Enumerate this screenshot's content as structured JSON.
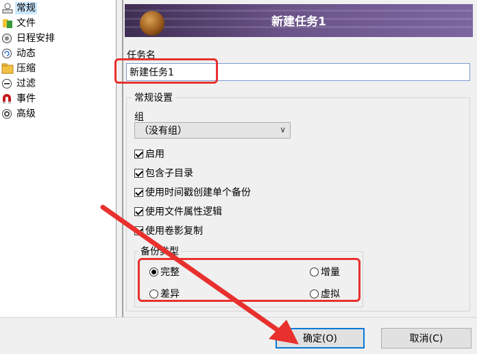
{
  "sidebar": {
    "items": [
      {
        "label": "常规",
        "icon": "general-icon",
        "selected": true
      },
      {
        "label": "文件",
        "icon": "file-icon"
      },
      {
        "label": "日程安排",
        "icon": "schedule-icon"
      },
      {
        "label": "动态",
        "icon": "dynamic-icon"
      },
      {
        "label": "压缩",
        "icon": "compress-icon"
      },
      {
        "label": "过滤",
        "icon": "filter-icon"
      },
      {
        "label": "事件",
        "icon": "event-icon"
      },
      {
        "label": "高级",
        "icon": "advanced-icon"
      }
    ]
  },
  "banner": {
    "title": "新建任务1"
  },
  "task_name": {
    "label": "任务名",
    "value": "新建任务1"
  },
  "general": {
    "legend": "常规设置",
    "group_label": "组",
    "group_value": "（没有组）",
    "checkboxes": [
      {
        "label": "启用",
        "checked": true
      },
      {
        "label": "包含子目录",
        "checked": true
      },
      {
        "label": "使用时间戳创建单个备份",
        "checked": true
      },
      {
        "label": "使用文件属性逻辑",
        "checked": true
      },
      {
        "label": "使用卷影复制",
        "checked": true
      }
    ]
  },
  "backup_type": {
    "legend": "备份类型",
    "options": [
      {
        "label": "完整",
        "selected": true
      },
      {
        "label": "增量",
        "selected": false
      },
      {
        "label": "差异",
        "selected": false
      },
      {
        "label": "虚拟",
        "selected": false
      }
    ]
  },
  "buttons": {
    "ok": "确定(O)",
    "cancel": "取消(C)"
  },
  "colors": {
    "annotation": "#e8312e",
    "selection": "#cce8ff",
    "focus": "#0078d7"
  }
}
